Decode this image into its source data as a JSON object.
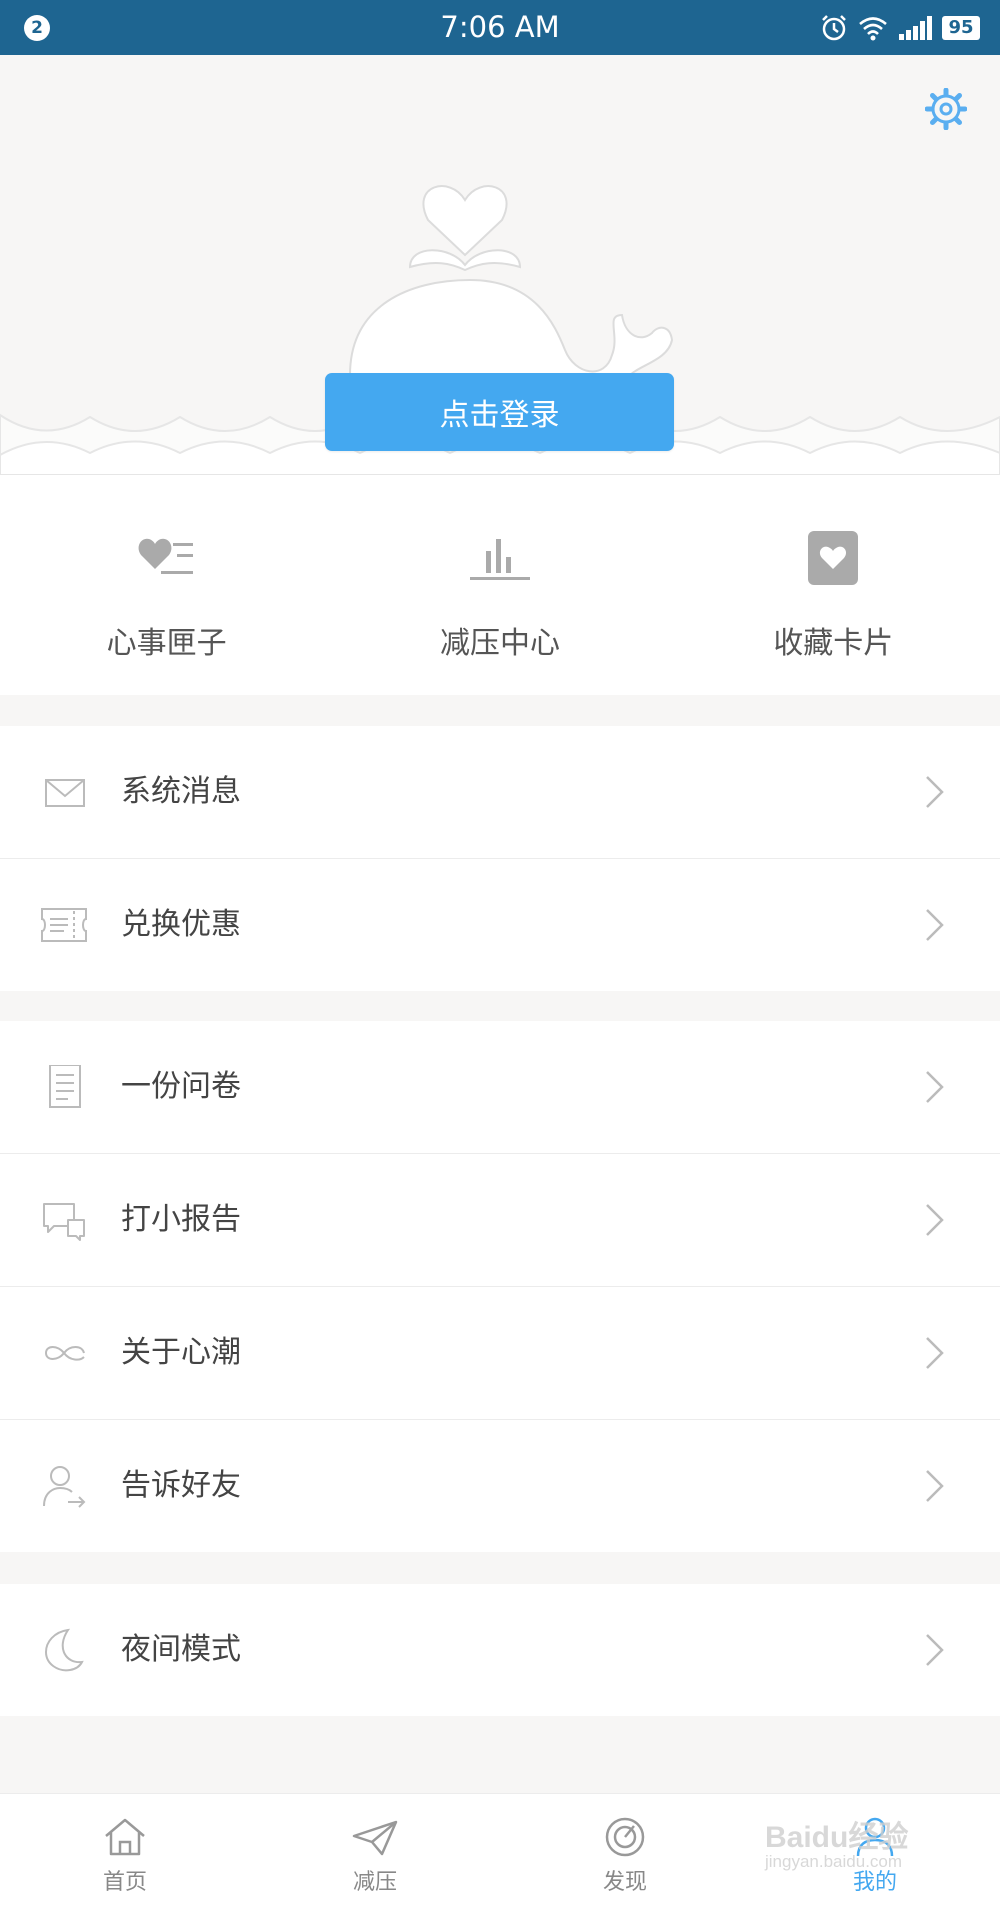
{
  "status_bar": {
    "notification_count": "2",
    "time": "7:06 AM",
    "battery": "95",
    "icons": [
      "alarm-icon",
      "wifi-icon",
      "signal-icon",
      "battery-icon"
    ]
  },
  "header": {
    "settings_icon": "gear-icon",
    "illustration": "whale-heart-illustration",
    "login_label": "点击登录"
  },
  "quick_actions": [
    {
      "label": "心事匣子",
      "icon": "heart-list-icon"
    },
    {
      "label": "减压中心",
      "icon": "bar-chart-icon"
    },
    {
      "label": "收藏卡片",
      "icon": "heart-card-icon"
    }
  ],
  "menu": {
    "group1": [
      {
        "label": "系统消息",
        "icon": "mail-icon"
      },
      {
        "label": "兑换优惠",
        "icon": "coupon-icon"
      }
    ],
    "group2": [
      {
        "label": "一份问卷",
        "icon": "document-icon"
      },
      {
        "label": "打小报告",
        "icon": "chat-bubbles-icon"
      },
      {
        "label": "关于心潮",
        "icon": "infinity-icon"
      },
      {
        "label": "告诉好友",
        "icon": "share-user-icon"
      }
    ],
    "group3": [
      {
        "label": "夜间模式",
        "icon": "moon-icon"
      }
    ]
  },
  "tabs": [
    {
      "label": "首页",
      "icon": "home-icon",
      "active": false
    },
    {
      "label": "减压",
      "icon": "paper-plane-icon",
      "active": false
    },
    {
      "label": "发现",
      "icon": "compass-icon",
      "active": false
    },
    {
      "label": "我的",
      "icon": "user-icon",
      "active": true
    }
  ],
  "colors": {
    "status_bar": "#1e6591",
    "accent": "#44a8f0",
    "background": "#f7f6f5"
  },
  "watermark": {
    "text": "Baidu经验",
    "sub": "jingyan.baidu.com"
  }
}
